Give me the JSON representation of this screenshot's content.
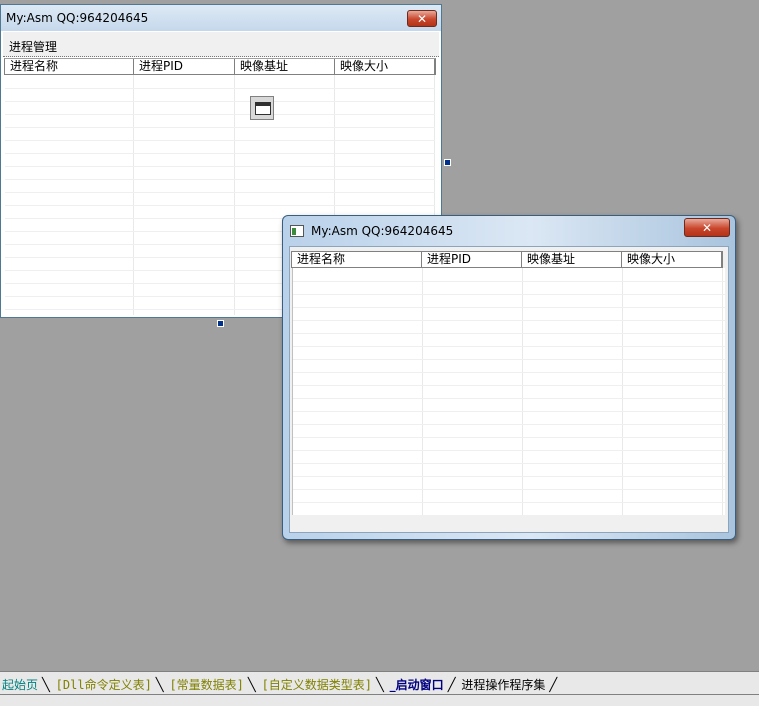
{
  "design_window": {
    "title": "My:Asm  QQ:964204645",
    "close_label": "✕",
    "menu": [
      "进程管理"
    ],
    "columns": [
      "进程名称",
      "进程PID",
      "映像基址",
      "映像大小"
    ]
  },
  "preview_window": {
    "title": "My:Asm  QQ:964204645",
    "close_label": "✕",
    "columns": [
      "进程名称",
      "进程PID",
      "映像基址",
      "映像大小"
    ]
  },
  "tabs": [
    {
      "label": "起始页",
      "style": "teal"
    },
    {
      "label": "[Dll命令定义表]",
      "style": "olive"
    },
    {
      "label": "[常量数据表]",
      "style": "olive"
    },
    {
      "label": "[自定义数据类型表]",
      "style": "olive"
    },
    {
      "label": "_启动窗口",
      "style": "active"
    },
    {
      "label": "进程操作程序集",
      "style": "plain"
    }
  ],
  "colors": {
    "workspace": "#a0a0a0",
    "close_button": "#c9462c",
    "active_tab": "#000080"
  }
}
